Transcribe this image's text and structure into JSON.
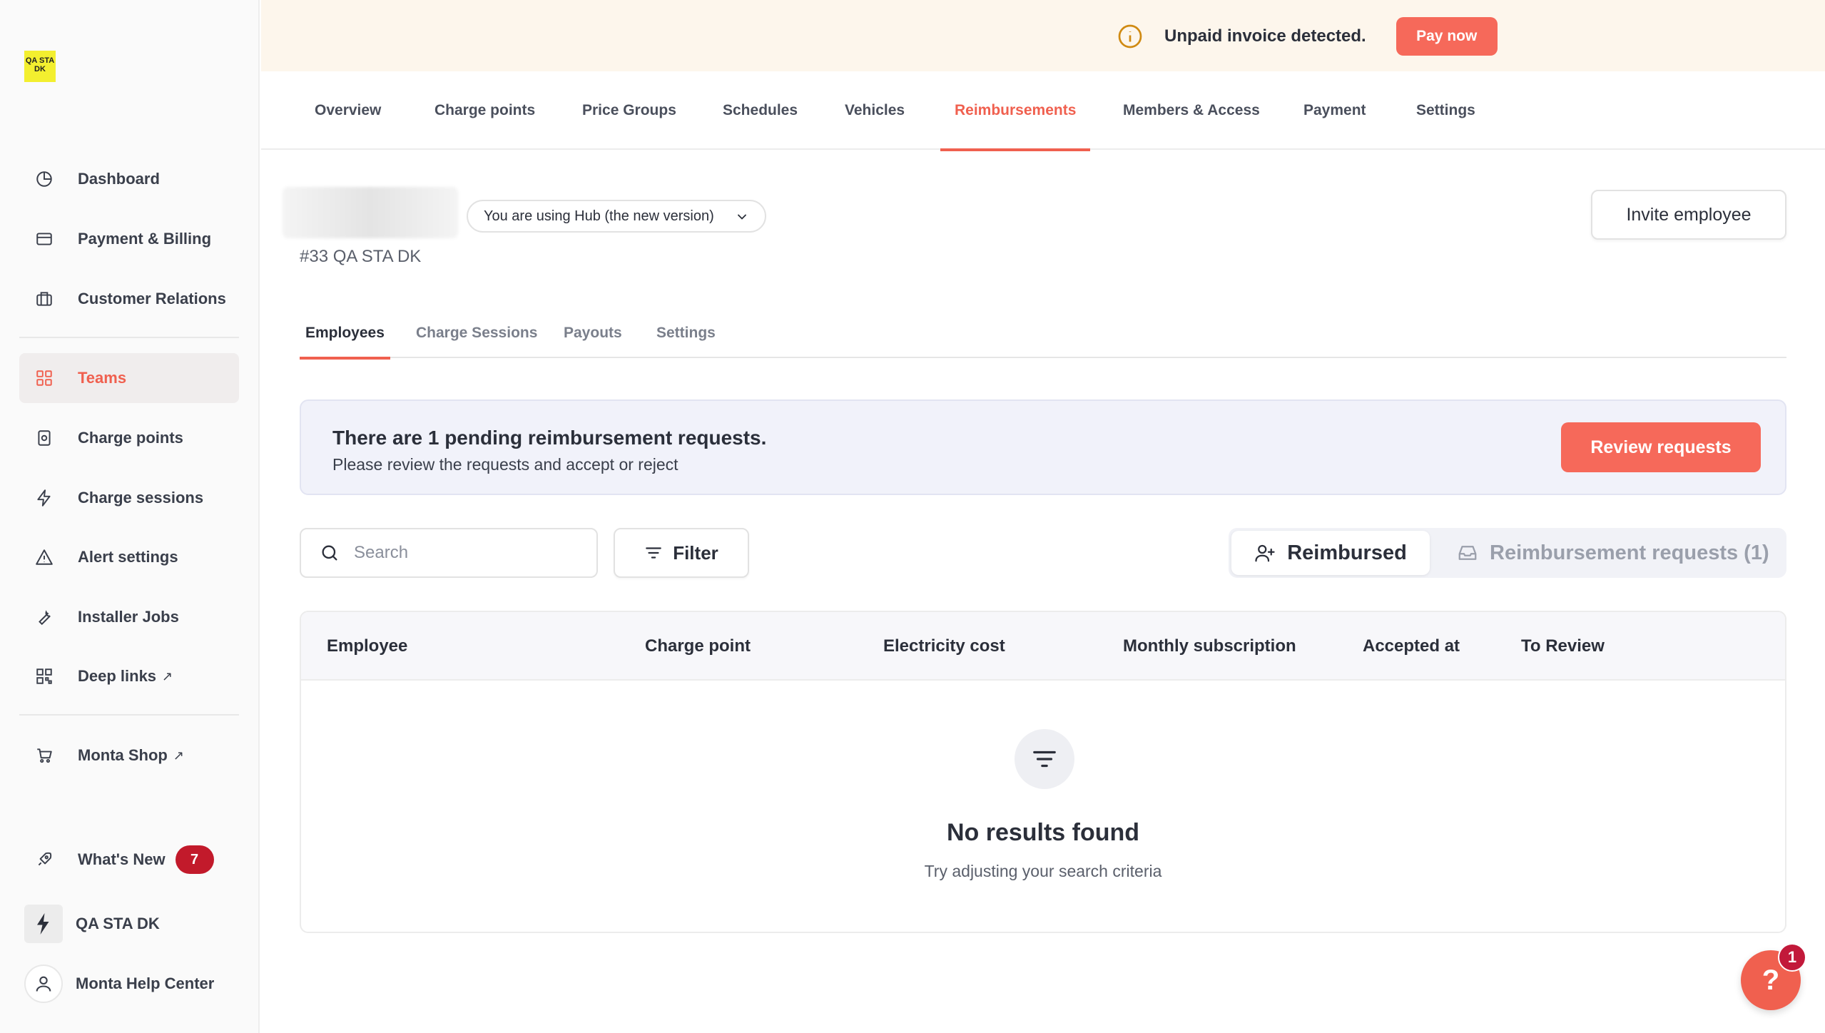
{
  "sidebar": {
    "logo_text": "QA STA DK",
    "items": [
      {
        "label": "Dashboard",
        "icon": "pie-chart-icon"
      },
      {
        "label": "Payment & Billing",
        "icon": "credit-card-icon"
      },
      {
        "label": "Customer Relations",
        "icon": "briefcase-icon"
      },
      {
        "label": "Teams",
        "icon": "grid-icon",
        "active": true
      },
      {
        "label": "Charge points",
        "icon": "charger-icon"
      },
      {
        "label": "Charge sessions",
        "icon": "lightning-icon"
      },
      {
        "label": "Alert settings",
        "icon": "alert-triangle-icon"
      },
      {
        "label": "Installer Jobs",
        "icon": "wrench-icon"
      },
      {
        "label": "Deep links",
        "icon": "qr-code-icon",
        "external": "↗"
      },
      {
        "label": "Monta Shop",
        "icon": "cart-icon",
        "external": "↗"
      }
    ],
    "whats_new": {
      "label": "What's New",
      "badge": "7"
    },
    "account": {
      "label": "QA STA DK"
    },
    "help_center": {
      "label": "Monta Help Center"
    }
  },
  "banner": {
    "text": "Unpaid invoice detected.",
    "button": "Pay now"
  },
  "top_tabs": [
    {
      "label": "Overview"
    },
    {
      "label": "Charge points"
    },
    {
      "label": "Price Groups"
    },
    {
      "label": "Schedules"
    },
    {
      "label": "Vehicles"
    },
    {
      "label": "Reimbursements",
      "active": true
    },
    {
      "label": "Members & Access"
    },
    {
      "label": "Payment"
    },
    {
      "label": "Settings"
    }
  ],
  "header": {
    "hub_select": "You are using Hub (the new version)",
    "org_name": "#33 QA STA DK",
    "invite_button": "Invite employee"
  },
  "sub_tabs": [
    {
      "label": "Employees",
      "active": true
    },
    {
      "label": "Charge Sessions"
    },
    {
      "label": "Payouts"
    },
    {
      "label": "Settings"
    }
  ],
  "pending": {
    "title": "There are 1 pending reimbursement requests.",
    "subtitle": "Please review the requests and accept or reject",
    "button": "Review requests"
  },
  "toolbar": {
    "search_placeholder": "Search",
    "filter_label": "Filter",
    "segment_active": "Reimbursed",
    "segment_inactive": "Reimbursement requests (1)"
  },
  "table": {
    "columns": [
      "Employee",
      "Charge point",
      "Electricity cost",
      "Monthly subscription",
      "Accepted at",
      "To Review"
    ],
    "empty_title": "No results found",
    "empty_subtitle": "Try adjusting your search criteria"
  },
  "help": {
    "symbol": "?",
    "badge": "1"
  },
  "colors": {
    "accent": "#f0604f",
    "banner_bg": "#fdf6ec",
    "badge_red": "#c21a2b"
  }
}
